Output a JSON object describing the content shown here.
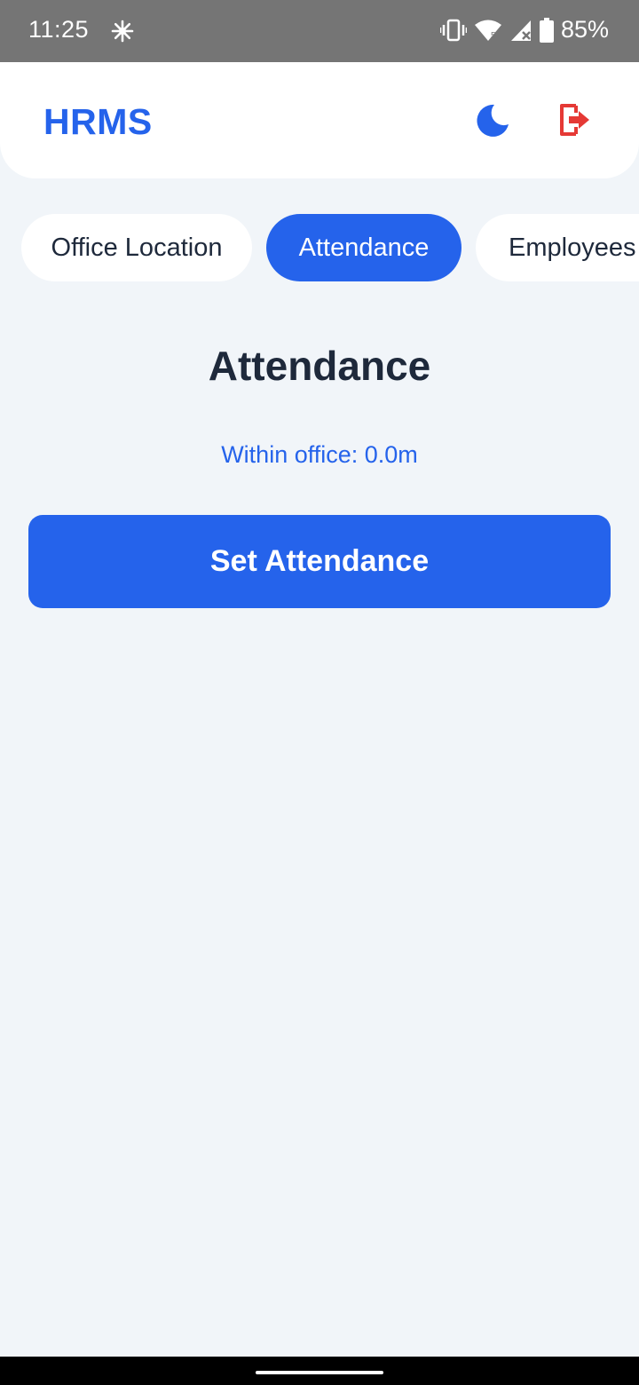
{
  "status_bar": {
    "time": "11:25",
    "left_icon": "fan-icon",
    "icons": [
      "vibrate-icon",
      "wifi-icon",
      "signal-icon",
      "battery-icon"
    ],
    "battery": "85%"
  },
  "header": {
    "title": "HRMS",
    "theme_icon": "moon-icon",
    "logout_icon": "logout-icon",
    "colors": {
      "brand": "#2563eb",
      "logout": "#e53935"
    }
  },
  "tabs": [
    {
      "label": "Office Location",
      "active": false
    },
    {
      "label": "Attendance",
      "active": true
    },
    {
      "label": "Employees",
      "active": false
    }
  ],
  "main": {
    "title": "Attendance",
    "distance_text": "Within office: 0.0m",
    "action_label": "Set Attendance"
  },
  "colors": {
    "background": "#f1f5f9",
    "accent": "#2563eb",
    "text": "#1e293b"
  }
}
